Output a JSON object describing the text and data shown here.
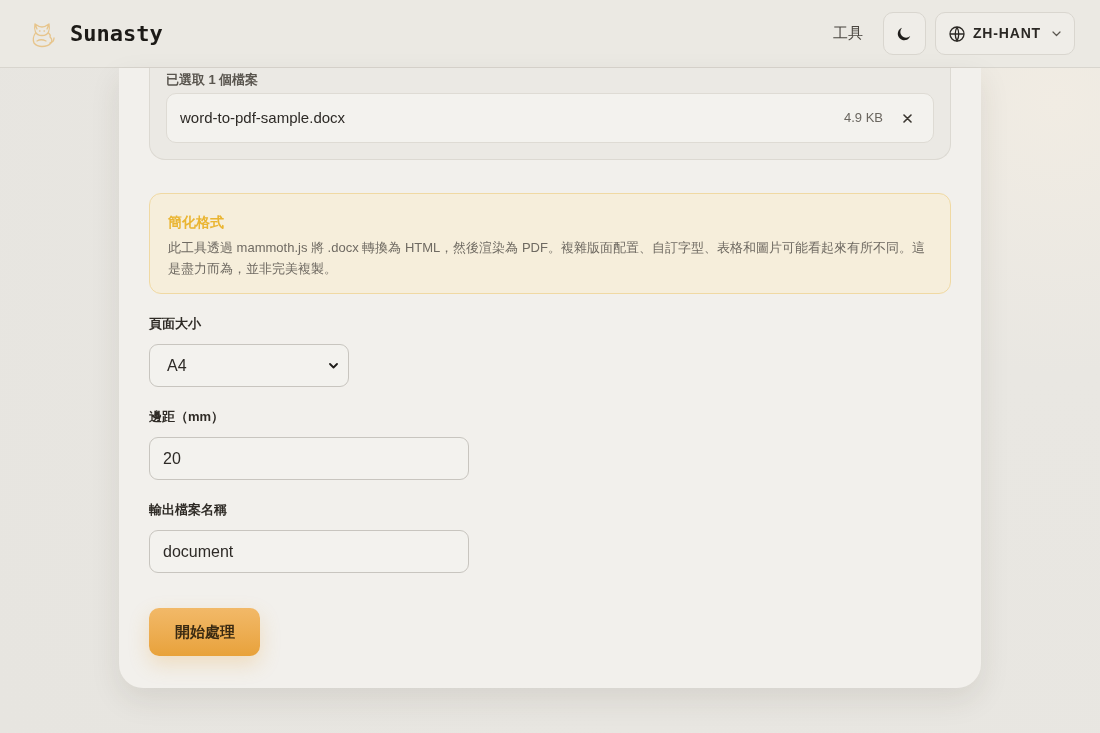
{
  "header": {
    "brand": "Sunasty",
    "nav_link": "工具",
    "language": "ZH-HANT"
  },
  "file_panel": {
    "label": "已選取 1 個檔案",
    "files": [
      {
        "name": "word-to-pdf-sample.docx",
        "size": "4.9 KB"
      }
    ]
  },
  "notice": {
    "title": "簡化格式",
    "text": "此工具透過 mammoth.js 將 .docx 轉換為 HTML，然後渲染為 PDF。複雜版面配置、自訂字型、表格和圖片可能看起來有所不同。這是盡力而為，並非完美複製。"
  },
  "fields": [
    {
      "kind": "select",
      "label": "頁面大小",
      "value": "A4"
    },
    {
      "kind": "input",
      "label": "邊距（mm）",
      "value": "20"
    },
    {
      "kind": "input",
      "label": "輸出檔案名稱",
      "value": "document"
    }
  ],
  "submit_button": "開始處理"
}
